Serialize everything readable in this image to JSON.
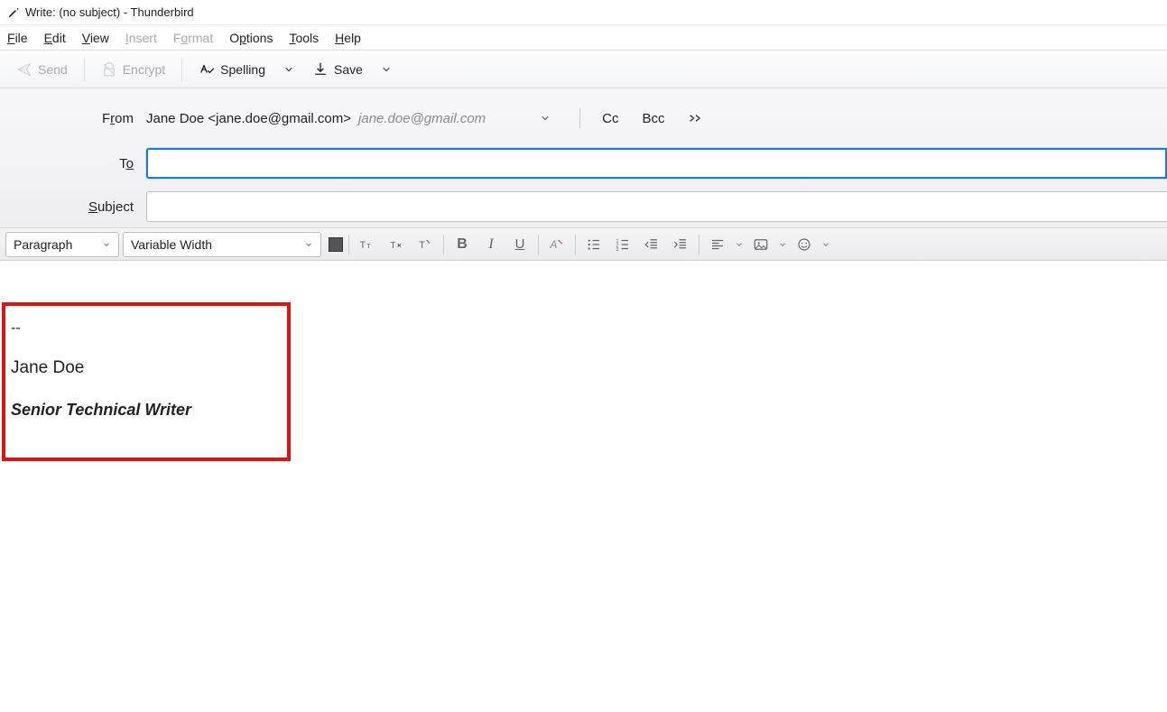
{
  "window": {
    "title": "Write: (no subject) - Thunderbird"
  },
  "menu": {
    "file": "File",
    "edit": "Edit",
    "view": "View",
    "insert": "Insert",
    "format": "Format",
    "options": "Options",
    "tools": "Tools",
    "help": "Help"
  },
  "toolbar": {
    "send": "Send",
    "encrypt": "Encrypt",
    "spelling": "Spelling",
    "save": "Save"
  },
  "addressing": {
    "from_label": "From",
    "from_identity": "Jane Doe <jane.doe@gmail.com>",
    "from_email_grey": "jane.doe@gmail.com",
    "to_label": "To",
    "to_value": "",
    "subject_label": "Subject",
    "subject_value": "",
    "cc": "Cc",
    "bcc": "Bcc"
  },
  "format": {
    "paragraph": "Paragraph",
    "font": "Variable Width"
  },
  "signature": {
    "sep": "--",
    "name": "Jane Doe",
    "title": "Senior Technical Writer"
  }
}
